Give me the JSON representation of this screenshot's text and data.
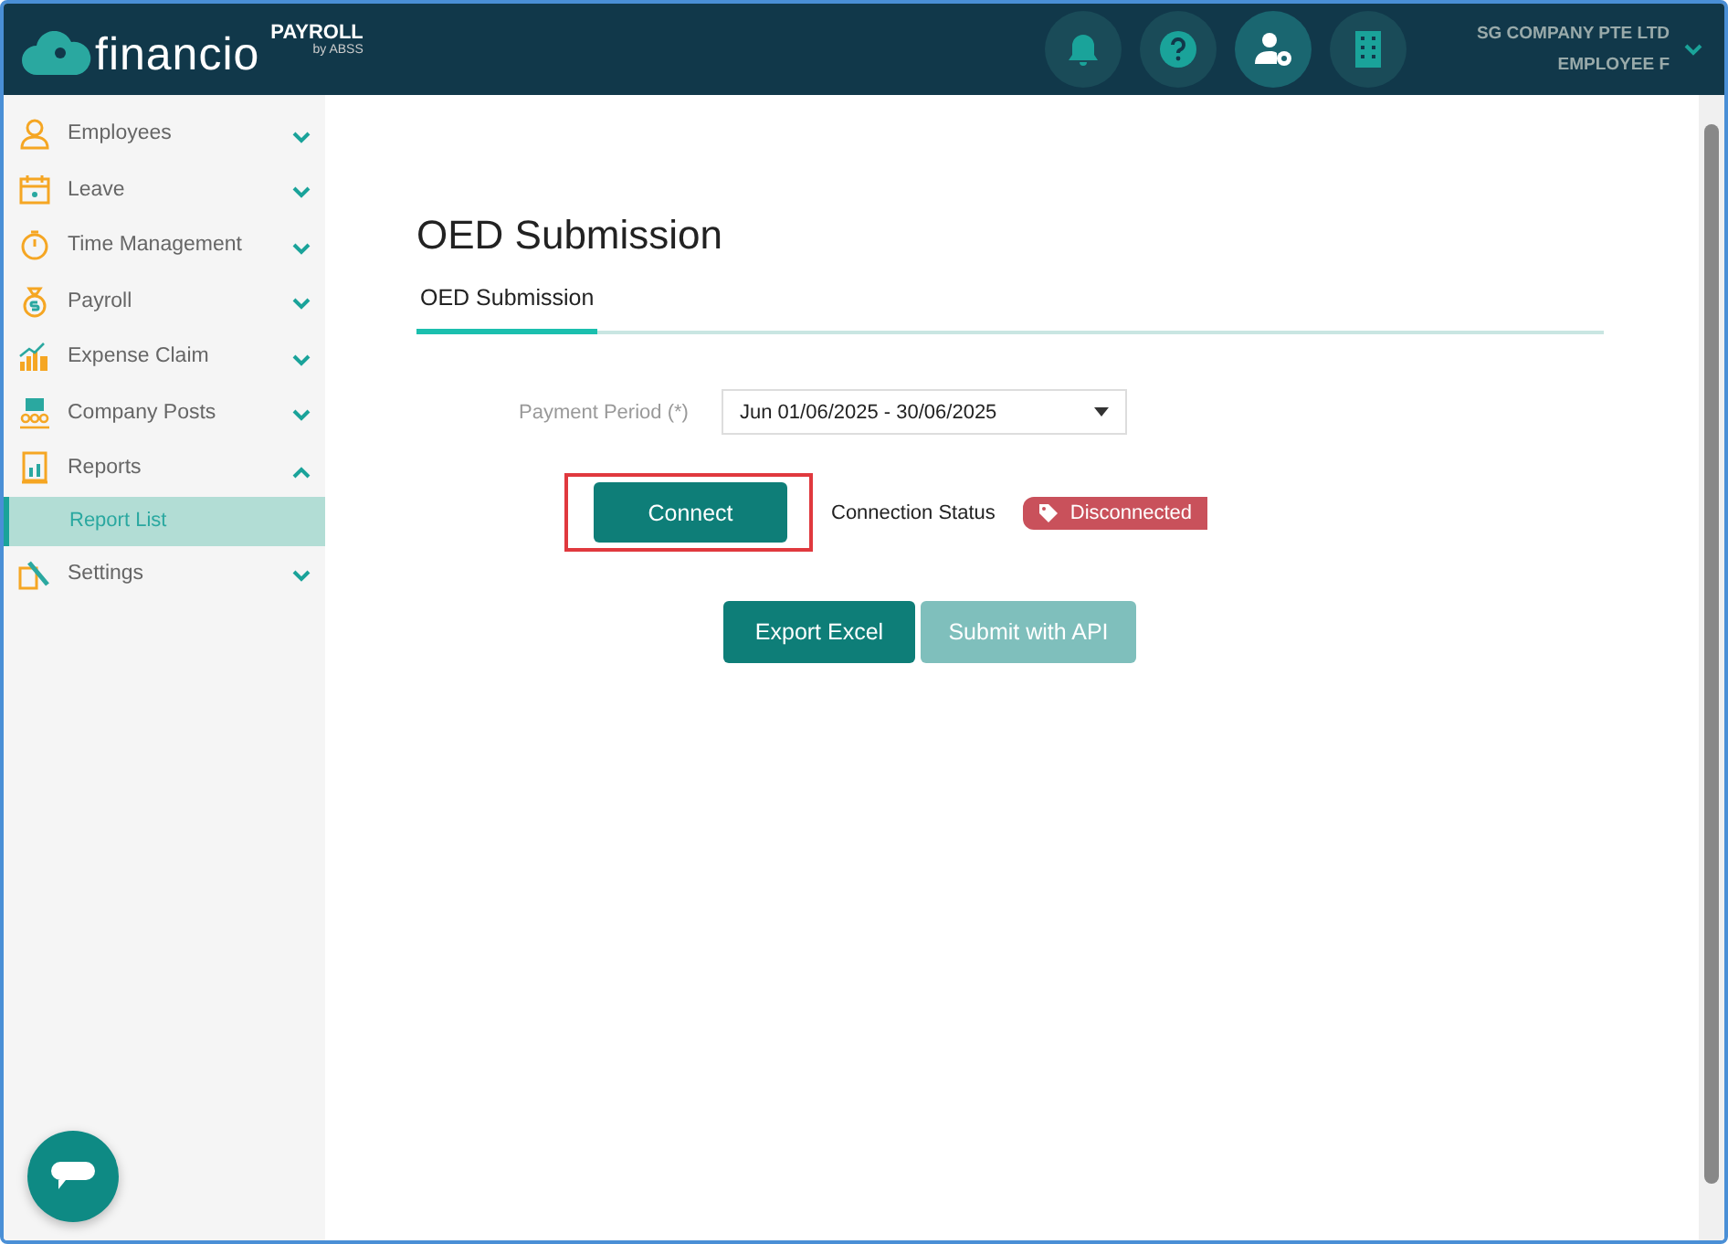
{
  "header": {
    "brand": "financio",
    "product": "PAYROLL",
    "vendor": "by ABSS",
    "icons": [
      {
        "kind": "bell",
        "selected": false
      },
      {
        "kind": "help",
        "selected": false
      },
      {
        "kind": "user-settings",
        "selected": true
      },
      {
        "kind": "building",
        "selected": false
      }
    ],
    "company": "SG COMPANY PTE LTD",
    "user": "EMPLOYEE F"
  },
  "sidebar": {
    "items": [
      {
        "kind": "person",
        "label": "Employees",
        "expanded": false
      },
      {
        "kind": "calendar",
        "label": "Leave",
        "expanded": false
      },
      {
        "kind": "stopwatch",
        "label": "Time Management",
        "expanded": false
      },
      {
        "kind": "moneybag",
        "label": "Payroll",
        "expanded": false
      },
      {
        "kind": "chart",
        "label": "Expense Claim",
        "expanded": false
      },
      {
        "kind": "board",
        "label": "Company Posts",
        "expanded": false
      },
      {
        "kind": "report",
        "label": "Reports",
        "expanded": true,
        "children": [
          {
            "label": "Report List",
            "selected": true
          }
        ]
      },
      {
        "kind": "tools",
        "label": "Settings",
        "expanded": false
      }
    ]
  },
  "page": {
    "title": "OED Submission",
    "tabs": [
      {
        "label": "OED Submission",
        "selected": true
      }
    ],
    "payment_period": {
      "label": "Payment Period (*)",
      "value": "Jun 01/06/2025 - 30/06/2025"
    },
    "connect_button": {
      "label": "Connect",
      "highlighted": true
    },
    "connection_status": {
      "label": "Connection Status",
      "badge": "Disconnected",
      "color": "#c9515b"
    },
    "buttons": [
      {
        "label": "Export Excel",
        "disabled": false
      },
      {
        "label": "Submit with API",
        "disabled": true
      }
    ]
  }
}
